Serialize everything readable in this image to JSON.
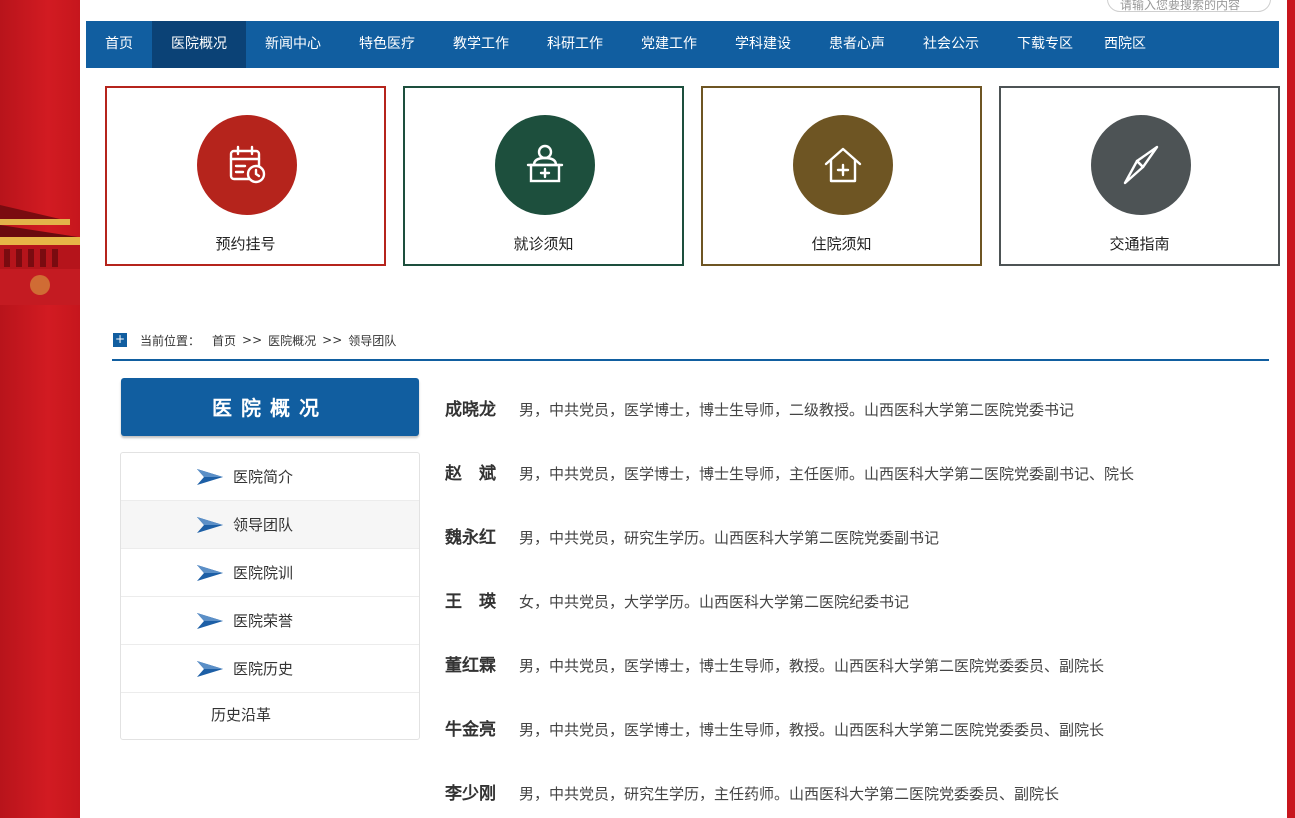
{
  "search": {
    "placeholder": "请输入您要搜索的内容"
  },
  "nav": {
    "items": [
      {
        "label": "首页",
        "active": false
      },
      {
        "label": "医院概况",
        "active": true
      },
      {
        "label": "新闻中心",
        "active": false
      },
      {
        "label": "特色医疗",
        "active": false
      },
      {
        "label": "教学工作",
        "active": false
      },
      {
        "label": "科研工作",
        "active": false
      },
      {
        "label": "党建工作",
        "active": false
      },
      {
        "label": "学科建设",
        "active": false
      },
      {
        "label": "患者心声",
        "active": false
      },
      {
        "label": "社会公示",
        "active": false
      },
      {
        "label": "下载专区",
        "active": false
      },
      {
        "label": "西院区",
        "active": false
      }
    ]
  },
  "quick_links": [
    {
      "label": "预约挂号",
      "icon": "calendar-clock-icon",
      "color": "#b5241c"
    },
    {
      "label": "就诊须知",
      "icon": "doctor-desk-icon",
      "color": "#1d4f3d"
    },
    {
      "label": "住院须知",
      "icon": "house-plus-icon",
      "color": "#6e5523"
    },
    {
      "label": "交通指南",
      "icon": "compass-icon",
      "color": "#4d5355"
    }
  ],
  "breadcrumb": {
    "prefix": "当前位置：",
    "items": [
      "首页",
      ">>",
      "医院概况",
      ">>",
      "领导团队"
    ]
  },
  "sidebar": {
    "title": "医院概况",
    "items": [
      {
        "label": "医院简介",
        "active": false
      },
      {
        "label": "领导团队",
        "active": true
      },
      {
        "label": "医院院训",
        "active": false
      },
      {
        "label": "医院荣誉",
        "active": false
      },
      {
        "label": "医院历史",
        "active": false
      }
    ],
    "sub_item": "历史沿革"
  },
  "leaders": [
    {
      "name": "成晓龙",
      "desc": "男，中共党员，医学博士，博士生导师，二级教授。山西医科大学第二医院党委书记"
    },
    {
      "name": "赵　斌",
      "desc": "男，中共党员，医学博士，博士生导师，主任医师。山西医科大学第二医院党委副书记、院长"
    },
    {
      "name": "魏永红",
      "desc": "男，中共党员，研究生学历。山西医科大学第二医院党委副书记"
    },
    {
      "name": "王　瑛",
      "desc": "女，中共党员，大学学历。山西医科大学第二医院纪委书记"
    },
    {
      "name": "董红霖",
      "desc": "男，中共党员，医学博士，博士生导师，教授。山西医科大学第二医院党委委员、副院长"
    },
    {
      "name": "牛金亮",
      "desc": "男，中共党员，医学博士，博士生导师，教授。山西医科大学第二医院党委委员、副院长"
    },
    {
      "name": "李少刚",
      "desc": "男，中共党员，研究生学历，主任药师。山西医科大学第二医院党委委员、副院长"
    }
  ],
  "colors": {
    "brand_blue": "#115ea0",
    "nav_active": "#0b4276",
    "side_red": "#c8161d"
  }
}
